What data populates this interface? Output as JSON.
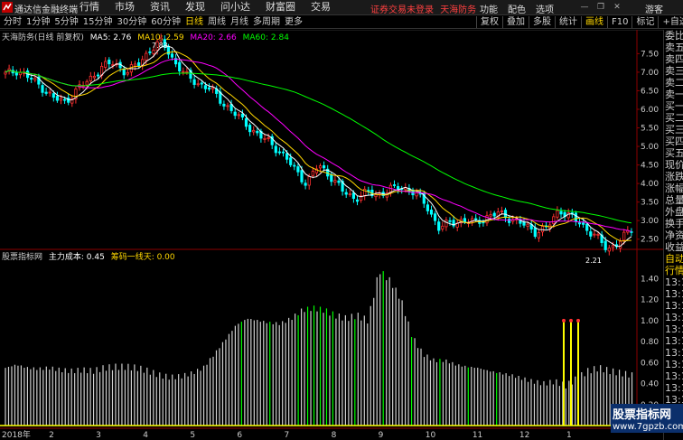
{
  "app": {
    "title": "通达信金融终端"
  },
  "menu": [
    "行情",
    "市场",
    "资讯",
    "发现",
    "问小达",
    "财富圈",
    "交易"
  ],
  "notice": "证券交易未登录",
  "stock_name_title": "天海防务",
  "right_menu": [
    "功能",
    "配色",
    "选项"
  ],
  "guest": "游客",
  "periods": [
    "分时",
    "1分钟",
    "5分钟",
    "15分钟",
    "30分钟",
    "60分钟",
    "日线",
    "周线",
    "月线",
    "多周期",
    "更多"
  ],
  "active_period": "日线",
  "tools": [
    "复权",
    "叠加",
    "多股",
    "统计",
    "画线",
    "F10",
    "标记",
    "+自选"
  ],
  "selected_tool": "画线",
  "main_info": {
    "stock": "天海防务(日线 前复权)",
    "ma5": "MA5: 2.76",
    "ma10": "MA10: 2.59",
    "ma20": "MA20: 2.66",
    "ma60": "MA60: 2.84"
  },
  "indicator_info": {
    "name": "股票指标网",
    "cost": "主力成本: 0.45",
    "chip": "筹码一线天: 0.00"
  },
  "price_annotations": {
    "high": "7.83",
    "low": "2.21"
  },
  "side_panel": [
    "委比",
    "卖五",
    "卖四",
    "卖三",
    "卖二",
    "卖一",
    "买一",
    "买二",
    "买三",
    "买四",
    "买五",
    "现价",
    "涨跌",
    "涨幅",
    "总量",
    "外盘",
    "换手",
    "净资",
    "收益",
    "自动",
    "行情",
    "13:1",
    "13:1",
    "13:1",
    "13:1",
    "13:1",
    "13:1",
    "13:1",
    "13:1",
    "13:1",
    "13:1",
    "13:1",
    "13:1",
    "13:1"
  ],
  "watermark": {
    "line1": "股票指标网",
    "line2": "www.7gpzb.com"
  },
  "colors": {
    "up": "#ff3030",
    "down": "#00ffff",
    "ma5": "#ffffff",
    "ma10": "#ffd700",
    "ma20": "#ff00ff",
    "ma60": "#00ff00"
  },
  "chart_data": [
    {
      "type": "candlestick",
      "title": "天海防务(日线 前复权)",
      "y_ticks": [
        7.5,
        7.0,
        6.5,
        6.0,
        5.5,
        5.0,
        4.5,
        4.0,
        3.5,
        3.0,
        2.5
      ],
      "ylim": [
        2.25,
        7.85
      ],
      "x_ticks": [
        "2018年",
        "2",
        "3",
        "4",
        "5",
        "6",
        "7",
        "8",
        "9",
        "10",
        "11",
        "12",
        "1"
      ],
      "series": [
        {
          "name": "MA5",
          "value": 2.76
        },
        {
          "name": "MA10",
          "value": 2.59
        },
        {
          "name": "MA20",
          "value": 2.66
        },
        {
          "name": "MA60",
          "value": 2.84
        }
      ],
      "close_path": [
        6.95,
        7.05,
        6.85,
        6.6,
        6.3,
        6.2,
        6.55,
        6.8,
        7.15,
        7.25,
        7.0,
        7.2,
        7.6,
        7.83,
        7.3,
        6.9,
        6.7,
        6.55,
        6.2,
        5.9,
        5.6,
        5.3,
        5.1,
        4.8,
        4.4,
        4.0,
        4.5,
        4.2,
        3.8,
        3.6,
        3.75,
        3.7,
        3.85,
        3.9,
        3.75,
        3.4,
        2.8,
        2.95,
        3.0,
        2.95,
        3.1,
        3.2,
        3.05,
        2.9,
        2.7,
        2.8,
        3.3,
        3.1,
        2.85,
        2.6,
        2.21,
        2.45,
        2.76
      ]
    },
    {
      "type": "bar",
      "title": "股票指标网",
      "y_ticks": [
        1.4,
        1.2,
        1.0,
        0.8,
        0.6,
        0.4,
        0.2
      ],
      "ylim": [
        0.0,
        1.55
      ],
      "series": [
        {
          "name": "主力成本",
          "value": 0.45
        },
        {
          "name": "筹码一线天",
          "value": 0.0
        }
      ],
      "profile": [
        0.55,
        0.58,
        0.55,
        0.54,
        0.55,
        0.53,
        0.52,
        0.53,
        0.52,
        0.55,
        0.56,
        0.56,
        0.55,
        0.52,
        0.48,
        0.46,
        0.47,
        0.5,
        0.55,
        0.68,
        0.82,
        0.96,
        1.02,
        1.0,
        0.98,
        0.97,
        1.02,
        1.1,
        1.12,
        1.1,
        1.05,
        1.02,
        1.05,
        1.0,
        1.48,
        1.38,
        1.2,
        0.85,
        0.68,
        0.62,
        0.62,
        0.58,
        0.56,
        0.55,
        0.52,
        0.5,
        0.48,
        0.45,
        0.42,
        0.4,
        0.42,
        0.38,
        0.45,
        0.52,
        0.55,
        0.52,
        0.5,
        0.48
      ]
    }
  ]
}
